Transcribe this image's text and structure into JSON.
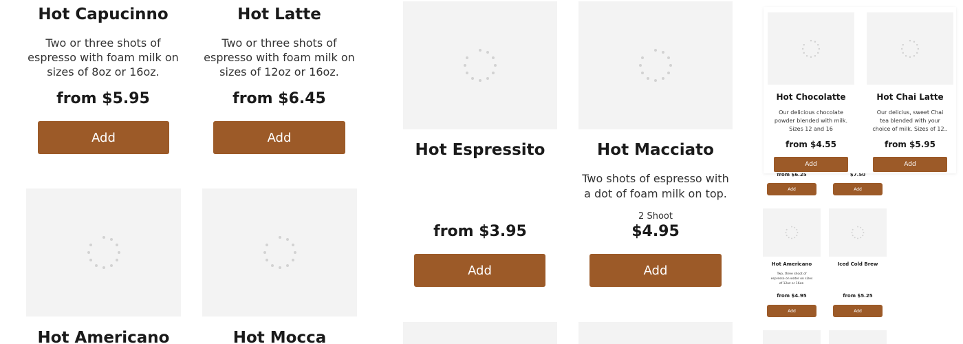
{
  "add_label": "Add",
  "colors": {
    "accent": "#9c5a28",
    "image_placeholder": "#f3f3f3",
    "spinner": "#d2d2d2"
  },
  "icons": {
    "loading": "loading-spinner-icon"
  },
  "col1": {
    "card1": {
      "title": "Hot Capucinno",
      "desc": [
        "Two or three shots of",
        "espresso with foam milk on",
        "sizes of 8oz or 16oz."
      ],
      "price": "from $5.95"
    },
    "card2": {
      "title": "Hot Americano"
    }
  },
  "col2": {
    "card1": {
      "title": "Hot Latte",
      "desc": [
        "Two or three shots of",
        "espresso with foam milk on",
        "sizes of 12oz or 16oz."
      ],
      "price": "from $6.45"
    },
    "card2": {
      "title": "Hot Mocca"
    }
  },
  "col3": {
    "card1": {
      "title": "Hot Espressito",
      "price": "from $3.95"
    }
  },
  "col4": {
    "card1": {
      "title": "Hot Macciato",
      "desc": [
        "Two shots of espresso with",
        "a dot of foam milk on top."
      ],
      "subtitle": "2 Shoot",
      "price": "$4.95"
    }
  },
  "mini": {
    "top": [
      {
        "title": "Hot Chocolatte",
        "desc": [
          "Our delicious chocolate",
          "powder blended with milk.",
          "Sizes 12 and 16"
        ],
        "price": "from $4.55"
      },
      {
        "title": "Hot Chai Latte",
        "desc": [
          "Our delicius, sweet Chai",
          "tea blended with your",
          "choice of milk. Sizes of 12.."
        ],
        "price": "from $5.95"
      }
    ],
    "peek_prices": [
      "from $6.25",
      "$7.50"
    ],
    "bottom": [
      {
        "title": "Hot Americano",
        "desc": [
          "Two, three shoot of",
          "espresso on water on sizes",
          "of 12oz or 16oz."
        ],
        "price": "from $4.95"
      },
      {
        "title": "Iced Cold Brew",
        "price": "from $5.25"
      }
    ]
  }
}
